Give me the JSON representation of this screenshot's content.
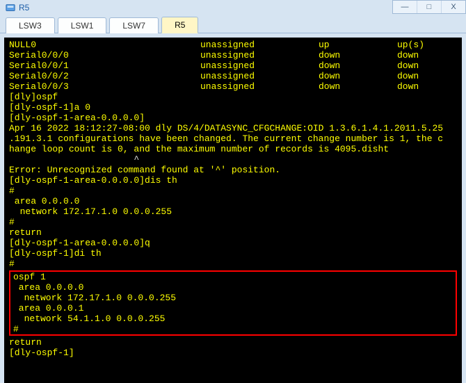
{
  "window": {
    "title": "R5",
    "min": "—",
    "max": "□",
    "close": "X"
  },
  "tabs": [
    {
      "label": "LSW3",
      "active": false
    },
    {
      "label": "LSW1",
      "active": false
    },
    {
      "label": "LSW7",
      "active": false
    },
    {
      "label": "R5",
      "active": true
    }
  ],
  "interfaces": [
    {
      "name": "NULL0",
      "ip": "unassigned",
      "phy": "up",
      "proto": "up(s)"
    },
    {
      "name": "Serial0/0/0",
      "ip": "unassigned",
      "phy": "down",
      "proto": "down"
    },
    {
      "name": "Serial0/0/1",
      "ip": "unassigned",
      "phy": "down",
      "proto": "down"
    },
    {
      "name": "Serial0/0/2",
      "ip": "unassigned",
      "phy": "down",
      "proto": "down"
    },
    {
      "name": "Serial0/0/3",
      "ip": "unassigned",
      "phy": "down",
      "proto": "down"
    }
  ],
  "lines": {
    "l01": "[dly]ospf",
    "l02": "[dly-ospf-1]a 0",
    "l03": "[dly-ospf-1-area-0.0.0.0]",
    "l04": "Apr 16 2022 18:12:27-08:00 dly DS/4/DATASYNC_CFGCHANGE:OID 1.3.6.1.4.1.2011.5.25",
    "l05": ".191.3.1 configurations have been changed. The current change number is 1, the c",
    "l06": "hange loop count is 0, and the maximum number of records is 4095.disht",
    "l07": "                       ^",
    "l08": "Error: Unrecognized command found at '^' position.",
    "l09": "[dly-ospf-1-area-0.0.0.0]dis th",
    "l10": "#",
    "l11": " area 0.0.0.0",
    "l12": "  network 172.17.1.0 0.0.0.255",
    "l13": "#",
    "l14": "return",
    "l15": "[dly-ospf-1-area-0.0.0.0]q",
    "l16": "[dly-ospf-1]di th",
    "l17": "#",
    "b01": "ospf 1",
    "b02": " area 0.0.0.0",
    "b03": "  network 172.17.1.0 0.0.0.255",
    "b04": " area 0.0.0.1",
    "b05": "  network 54.1.1.0 0.0.0.255",
    "b06": "#",
    "l18": "return",
    "l19": "[dly-ospf-1]"
  }
}
